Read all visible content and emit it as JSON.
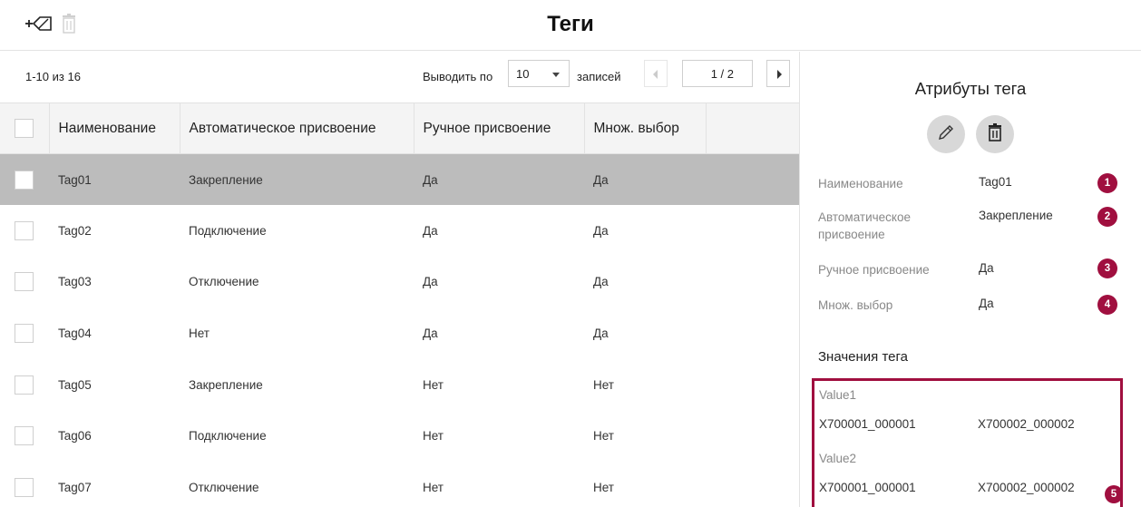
{
  "header": {
    "title": "Теги",
    "add_tag_icon": "add-tag-icon",
    "delete_icon": "trash-icon"
  },
  "pager": {
    "range_text": "1-10 из 16",
    "show_label": "Выводить по",
    "per_page": "10",
    "records_label": "записей",
    "page": "1 / 2"
  },
  "table": {
    "columns": [
      "Наименование",
      "Автоматическое присвоение",
      "Ручное присвоение",
      "Множ. выбор"
    ],
    "rows": [
      [
        "Tag01",
        "Закрепление",
        "Да",
        "Да"
      ],
      [
        "Tag02",
        "Подключение",
        "Да",
        "Да"
      ],
      [
        "Tag03",
        "Отключение",
        "Да",
        "Да"
      ],
      [
        "Tag04",
        "Нет",
        "Да",
        "Да"
      ],
      [
        "Tag05",
        "Закрепление",
        "Нет",
        "Нет"
      ],
      [
        "Tag06",
        "Подключение",
        "Нет",
        "Нет"
      ],
      [
        "Tag07",
        "Отключение",
        "Нет",
        "Нет"
      ]
    ],
    "selected_row": 0
  },
  "panel": {
    "title": "Атрибуты тега",
    "attributes": [
      {
        "label": "Наименование",
        "value": "Tag01",
        "badge": "1"
      },
      {
        "label": "Автоматическое присвоение",
        "value": "Закрепление",
        "badge": "2"
      },
      {
        "label": "Ручное присвоение",
        "value": "Да",
        "badge": "3"
      },
      {
        "label": "Множ. выбор",
        "value": "Да",
        "badge": "4"
      }
    ],
    "values_title": "Значения тега",
    "values": [
      {
        "name": "Value1",
        "cells": [
          "X700001_000001",
          "X700002_000002"
        ]
      },
      {
        "name": "Value2",
        "cells": [
          "X700001_000001",
          "X700002_000002"
        ]
      }
    ],
    "values_badge": "5"
  },
  "colors": {
    "accent": "#a00f3f",
    "selected_row": "#bcbcbc",
    "header_bg": "#f4f4f4"
  }
}
